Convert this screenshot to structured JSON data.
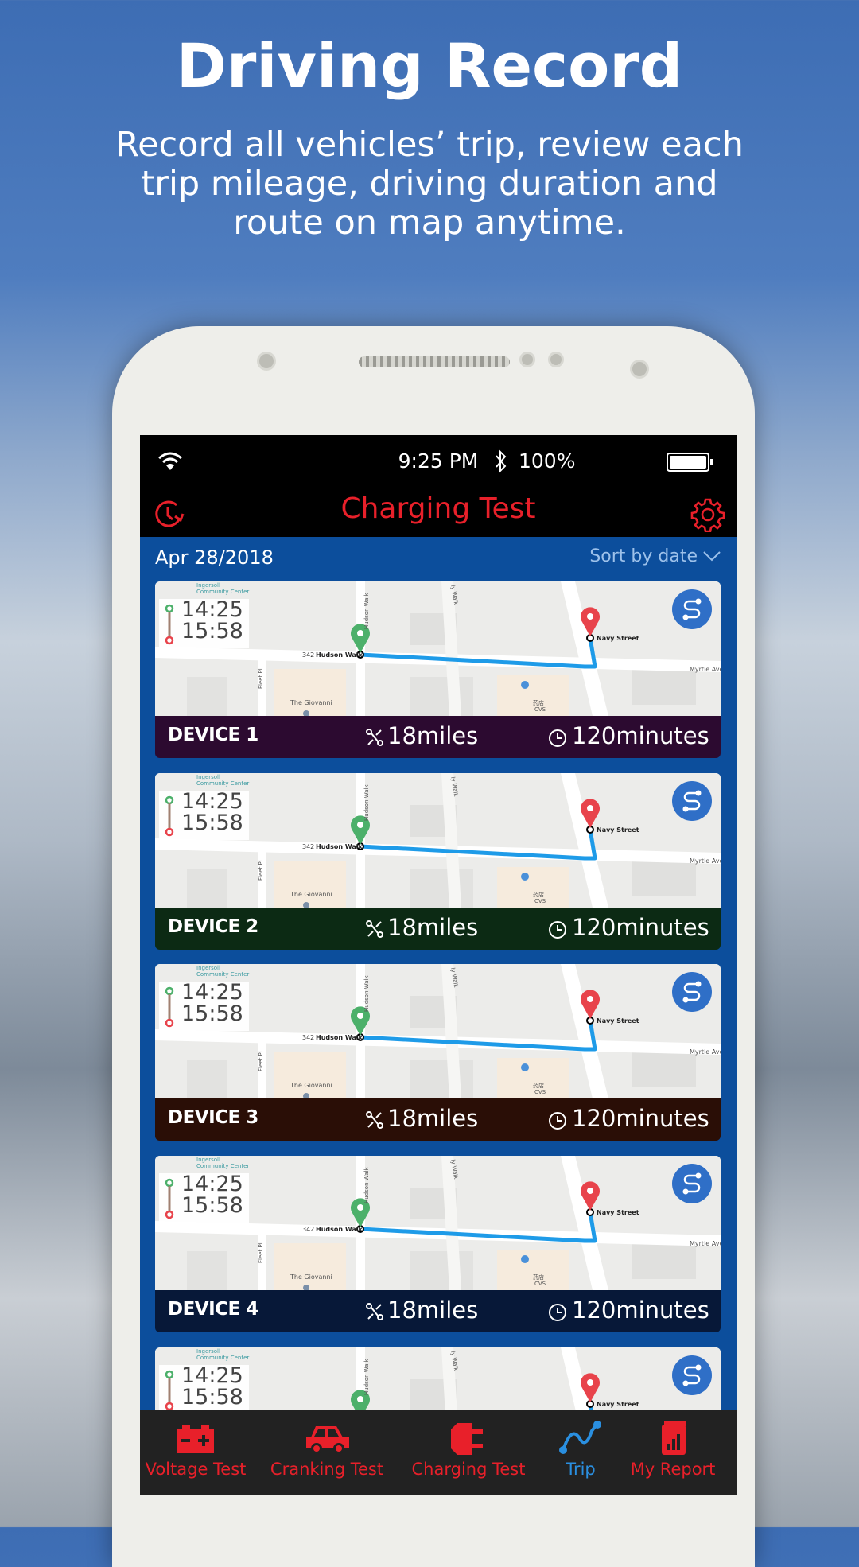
{
  "promo": {
    "title": "Driving Record",
    "subtitle_lines": [
      "Record all vehicles’ trip, review each",
      "trip mileage, driving duration and",
      "route on map anytime."
    ]
  },
  "status_bar": {
    "time": "9:25 PM",
    "battery": "100%",
    "icons": [
      "wifi-icon",
      "bluetooth-icon",
      "battery-icon"
    ]
  },
  "app_bar": {
    "title": "Charging Test",
    "left_icon": "history-icon",
    "right_icon": "gear-icon"
  },
  "list_header": {
    "date": "Apr 28/2018",
    "sort_label": "Sort by date"
  },
  "map_labels": {
    "community": "Ingersoll",
    "community2": "Community Center",
    "hudson_num": "342",
    "hudson": "Hudson Walk",
    "hudson_v": "Hudson Walk",
    "navy": "Navy Street",
    "fleet": "Fleet Pl",
    "giovanni": "The Giovanni",
    "cvs_cn": "药店",
    "cvs": "CVS",
    "myrtle": "Myrtle Ave",
    "walk": "Walk",
    "vert_walk": "ly Walk"
  },
  "trips": [
    {
      "device": "DEVICE 1",
      "start": "14:25",
      "end": "15:58",
      "distance": "18miles",
      "duration": "120minutes",
      "bar_color": "#2c0a30"
    },
    {
      "device": "DEVICE 2",
      "start": "14:25",
      "end": "15:58",
      "distance": "18miles",
      "duration": "120minutes",
      "bar_color": "#0c2a14"
    },
    {
      "device": "DEVICE 3",
      "start": "14:25",
      "end": "15:58",
      "distance": "18miles",
      "duration": "120minutes",
      "bar_color": "#2a0e06"
    },
    {
      "device": "DEVICE 4",
      "start": "14:25",
      "end": "15:58",
      "distance": "18miles",
      "duration": "120minutes",
      "bar_color": "#071838"
    },
    {
      "device": "",
      "start": "14:25",
      "end": "15:58",
      "distance": "",
      "duration": "",
      "bar_color": "#071838"
    }
  ],
  "bottom_nav": [
    {
      "label": "Voltage Test",
      "icon": "battery-icon",
      "active": false
    },
    {
      "label": "Cranking Test",
      "icon": "car-icon",
      "active": false
    },
    {
      "label": "Charging Test",
      "icon": "plug-icon",
      "active": false
    },
    {
      "label": "Trip",
      "icon": "route-icon",
      "active": true
    },
    {
      "label": "My Report",
      "icon": "report-icon",
      "active": false
    }
  ],
  "colors": {
    "accent_red": "#e8202a",
    "active_blue": "#2a8fe0",
    "list_bg": "#0c4e9c",
    "route": "#1e9be8"
  }
}
